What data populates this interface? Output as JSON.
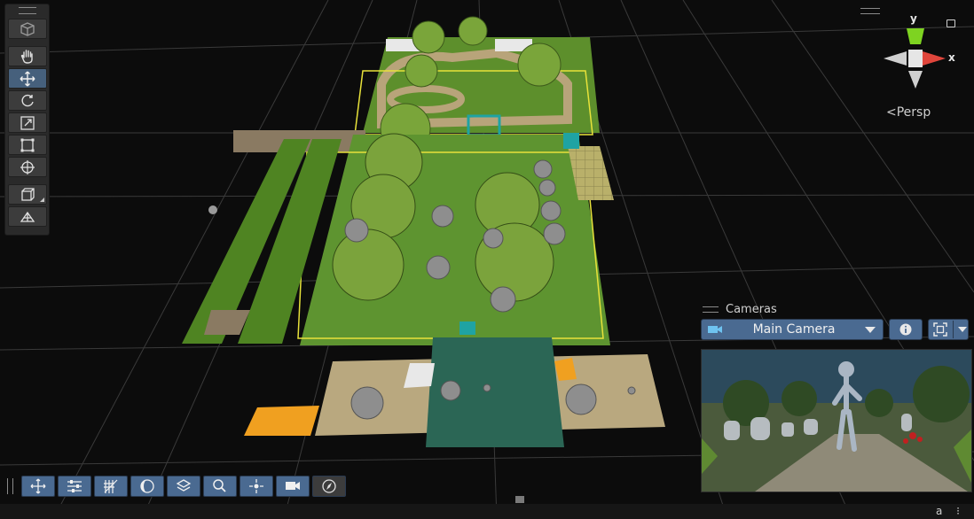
{
  "scene_view": {
    "gizmo": {
      "y_label": "y",
      "x_label": "x",
      "projection_label": "Persp"
    }
  },
  "left_toolbar": {
    "tools": [
      "view-cube",
      "hand",
      "move",
      "rotate",
      "scale",
      "rect",
      "transform",
      "view-options",
      "orientation"
    ],
    "active_tool": "move"
  },
  "cameras_overlay": {
    "title": "Cameras",
    "selected_camera": "Main Camera"
  },
  "bottom_toolbar": {
    "tools": [
      "move-handle",
      "sliders",
      "grid-snap",
      "shading",
      "gizmos",
      "search",
      "pivot",
      "camera-view",
      "compass"
    ]
  },
  "colors": {
    "accent": "#4a6a91",
    "active_tool": "#46607c",
    "background": "#0c0c0c",
    "selection_outline": "#e8e23a"
  }
}
